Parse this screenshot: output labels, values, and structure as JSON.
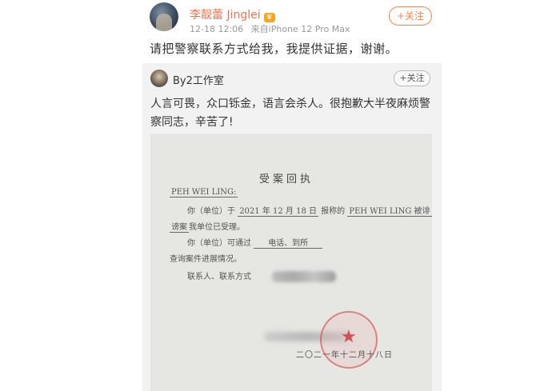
{
  "post": {
    "author": "李靓蕾 Jinglei",
    "badge": "♛",
    "date": "12-18 12:06",
    "source": "来自iPhone 12 Pro Max",
    "follow_label": "+关注",
    "text": "请把警察联系方式给我，我提供证据，谢谢。"
  },
  "quoted_post": {
    "author": "By2工作室",
    "follow_label": "+关注",
    "text": "人言可畏，众口铄金，语言会杀人。很抱歉大半夜麻烦警察同志，辛苦了!"
  },
  "document": {
    "title": "受案回执",
    "recipient": "PEH WEI LING:",
    "line1_prefix": "你（单位）于",
    "line1_date": "2021 年 12 月 18 日",
    "line1_mid": "报称的",
    "line1_name": "PEH WEI LING 被诽",
    "line2_under": "谤案",
    "line2_rest": "我单位已受理。",
    "line3_prefix": "你（单位）可通过",
    "line3_method": "电话、到所",
    "line4": "查询案件进展情况。",
    "line5": "联系人、联系方式",
    "date_footer": "二〇二一年十二月十八日",
    "seal_icon": "★"
  },
  "colors": {
    "author_orange": "#eb7350",
    "follow_orange": "#ff8140",
    "seal_red": "#d23c3c"
  }
}
